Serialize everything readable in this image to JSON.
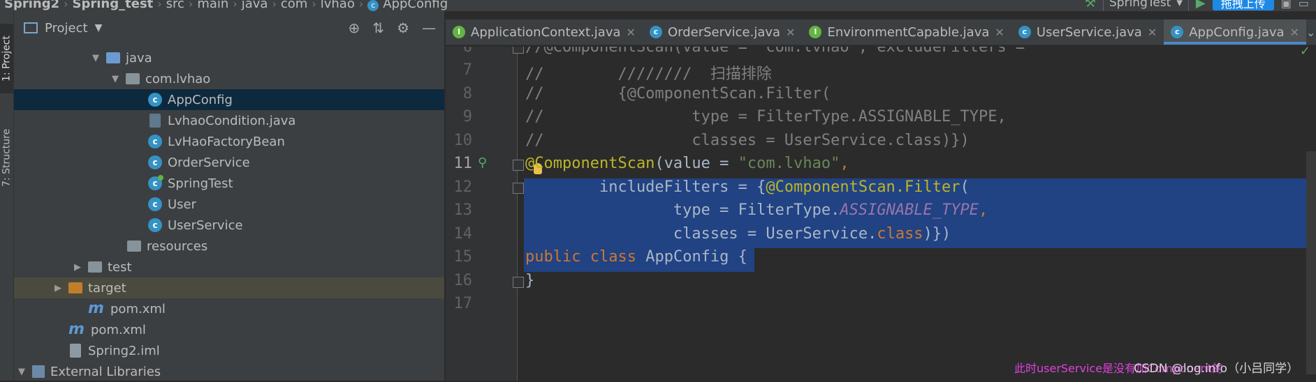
{
  "breadcrumb": [
    "Spring2",
    "Spring_test",
    "src",
    "main",
    "java",
    "com",
    "lvhao",
    "AppConfig"
  ],
  "toolbar": {
    "run_config": "SpringTest",
    "upload_label": "拖拽上传"
  },
  "side_tabs": {
    "project": "1: Project",
    "structure": "7: Structure"
  },
  "project_panel": {
    "title": "Project",
    "tree": [
      {
        "label": "java",
        "icon": "folder-blue",
        "expanded": true
      },
      {
        "label": "com.lvhao",
        "icon": "package",
        "expanded": true
      },
      {
        "label": "AppConfig",
        "icon": "class",
        "selected": true
      },
      {
        "label": "LvhaoCondition.java",
        "icon": "java-file"
      },
      {
        "label": "LvHaoFactoryBean",
        "icon": "class"
      },
      {
        "label": "OrderService",
        "icon": "class"
      },
      {
        "label": "SpringTest",
        "icon": "spring-class"
      },
      {
        "label": "User",
        "icon": "class"
      },
      {
        "label": "UserService",
        "icon": "class"
      },
      {
        "label": "resources",
        "icon": "folder-resources"
      },
      {
        "label": "test",
        "icon": "folder",
        "collapsed": true
      },
      {
        "label": "target",
        "icon": "folder-orange",
        "collapsed": true
      },
      {
        "label": "pom.xml",
        "icon": "maven"
      },
      {
        "label": "pom.xml",
        "icon": "maven"
      },
      {
        "label": "Spring2.iml",
        "icon": "iml"
      },
      {
        "label": "External Libraries",
        "icon": "library",
        "expanded": true
      }
    ]
  },
  "tabs": [
    {
      "label": "ApplicationContext.java",
      "icon": "interface-icon"
    },
    {
      "label": "OrderService.java",
      "icon": "class-icon"
    },
    {
      "label": "EnvironmentCapable.java",
      "icon": "interface-icon"
    },
    {
      "label": "UserService.java",
      "icon": "class-icon"
    },
    {
      "label": "AppConfig.java",
      "icon": "class-icon",
      "active": true
    }
  ],
  "editor": {
    "line_numbers": [
      "6",
      "7",
      "8",
      "9",
      "10",
      "11",
      "12",
      "13",
      "14",
      "15",
      "16",
      "17"
    ],
    "current_line": "11",
    "lines": [
      {
        "t": "//@ComponentScan(value = \"com.lvhao\", excludeFilters ="
      },
      {
        "t": "//        ////////  扫描排除"
      },
      {
        "t": "//        {@ComponentScan.Filter("
      },
      {
        "t": "//                type = FilterType.ASSIGNABLE_TYPE,"
      },
      {
        "t": "//                classes = UserService.class)})"
      }
    ],
    "code_tokens": {
      "l11": [
        "@ComponentScan",
        "(value = ",
        "\"com.lvhao\"",
        ","
      ],
      "l12": [
        "        includeFilters = {",
        "@ComponentScan.Filter",
        "("
      ],
      "l13": [
        "                type = FilterType.",
        "ASSIGNABLE_TYPE",
        ","
      ],
      "l14": [
        "                classes = UserService.",
        "class",
        ")})"
      ],
      "l15": [
        "public",
        " ",
        "class",
        " AppConfig {"
      ],
      "l16": [
        "}"
      ]
    }
  },
  "overlay": {
    "tooltip": "此时userService是没有加Component的",
    "watermark": "CSDN @log.info（小吕同学）"
  }
}
